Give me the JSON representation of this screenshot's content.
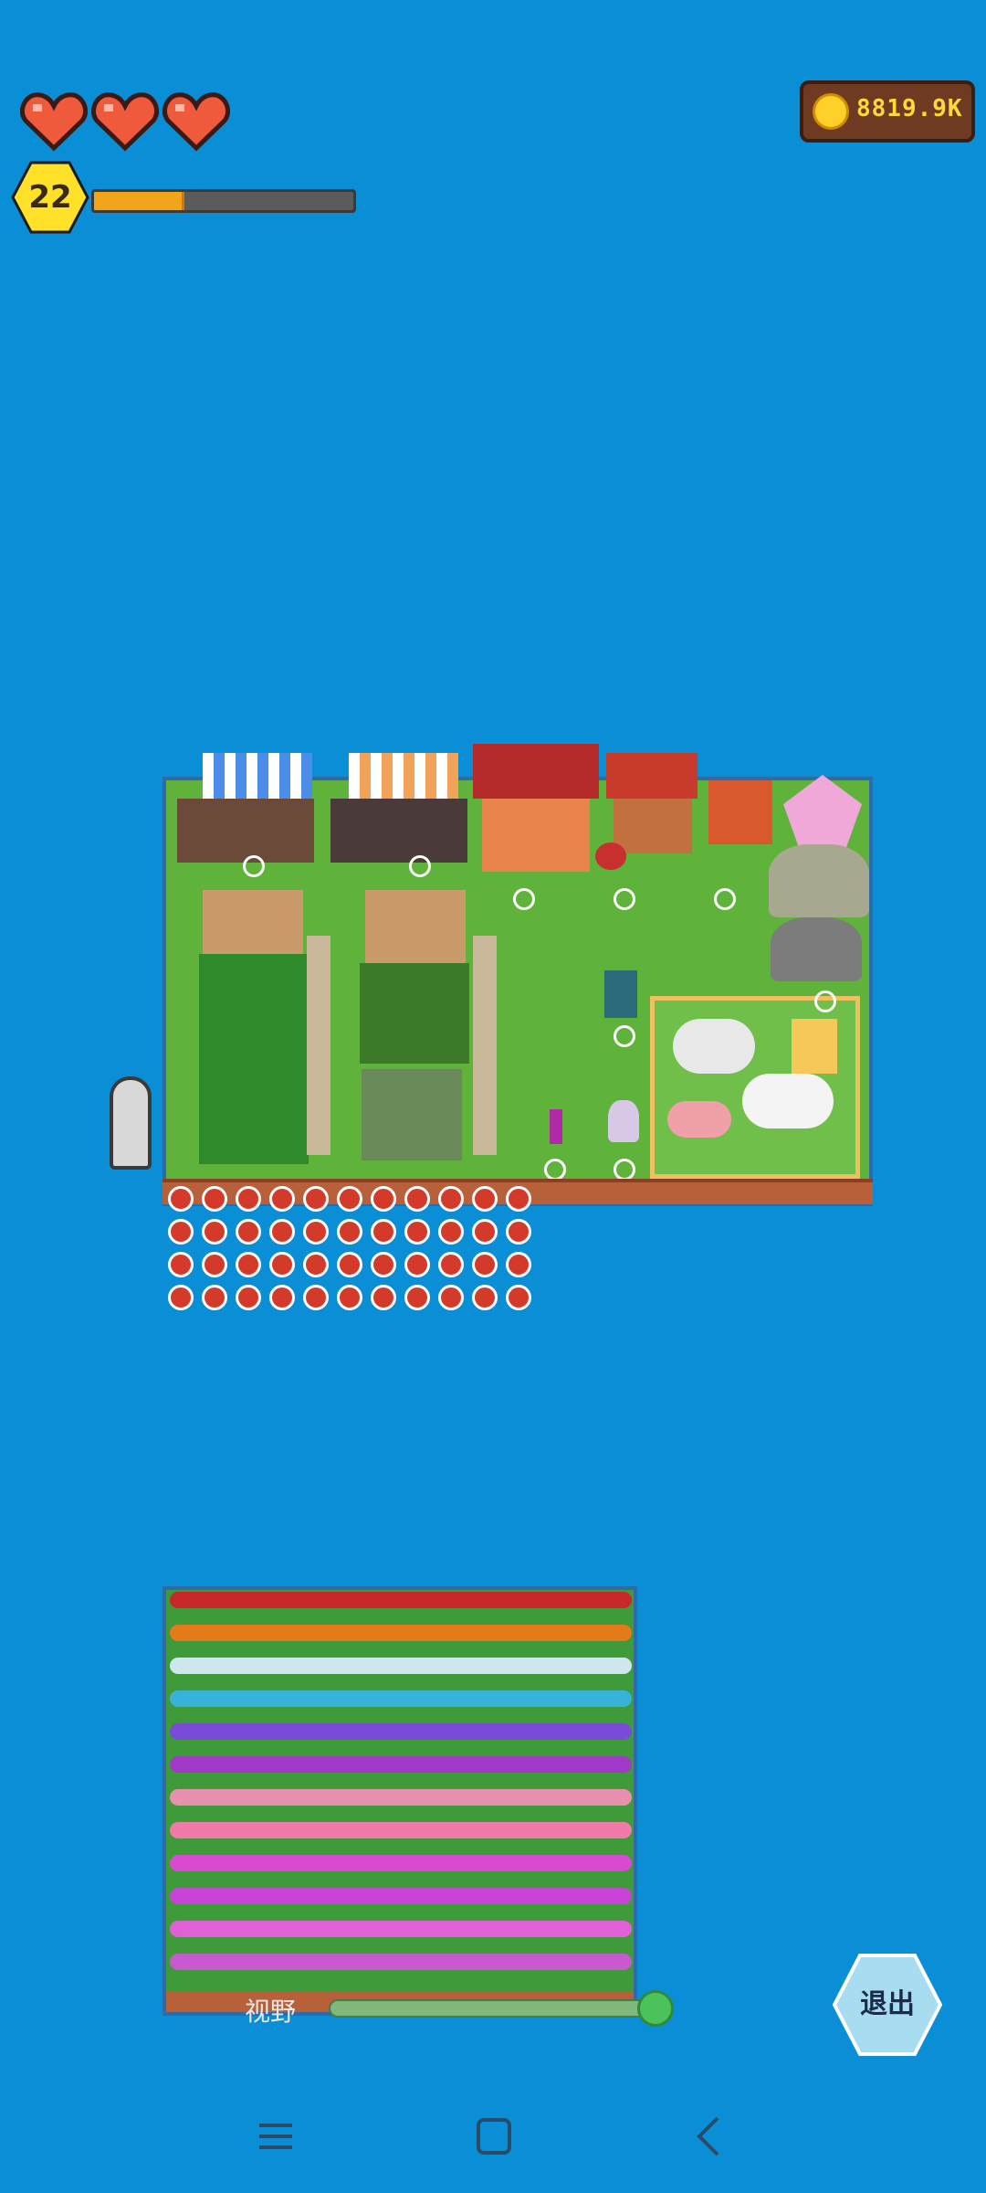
{
  "hud": {
    "hearts": 3,
    "level": "22",
    "xp_fraction": 0.35,
    "coins": "8819.9K"
  },
  "colors": {
    "sea": "#0a8fd6",
    "grass": "#5fb33a",
    "xp_fill": "#f3a41b",
    "coin_box": "#6e3a22",
    "exit_button": "#a8dcf0"
  },
  "view": {
    "label": "视野",
    "level": 1.0
  },
  "exit": {
    "label": "退出"
  },
  "navbar": {
    "icons": [
      "menu-icon",
      "home-icon",
      "back-icon"
    ]
  }
}
